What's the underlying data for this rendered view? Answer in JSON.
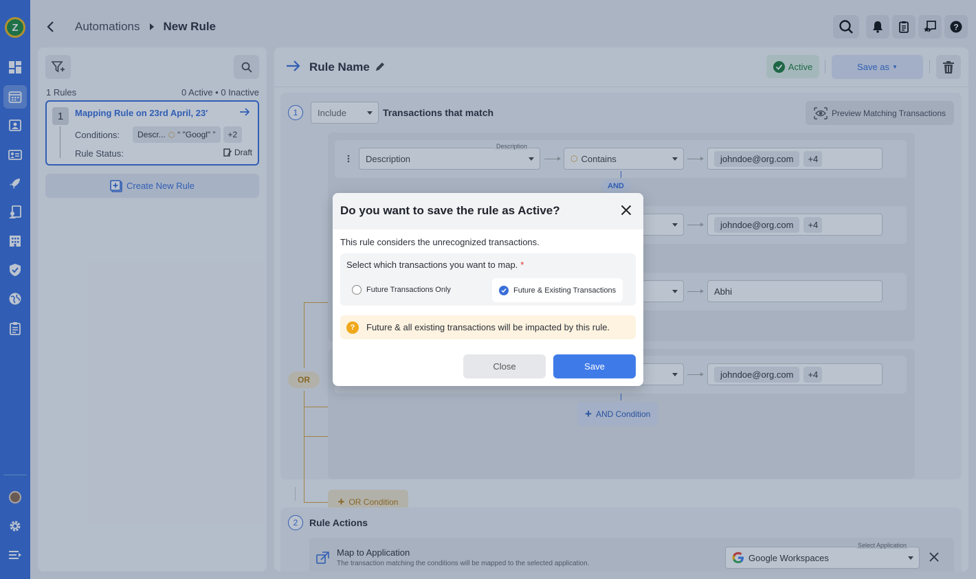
{
  "header": {
    "breadcrumb_parent": "Automations",
    "breadcrumb_current": "New Rule"
  },
  "rail": {
    "logo": "Z",
    "icons": [
      "dashboard-icon",
      "calendar-icon",
      "contacts-icon",
      "id-card-icon",
      "rocket-icon",
      "user-doc-icon",
      "building-icon",
      "shield-icon",
      "globe-icon",
      "clipboard-icon",
      "settings-icon",
      "menu-icon"
    ]
  },
  "rules_panel": {
    "count_label": "1 Rules",
    "stats_label": "0 Active • 0 Inactive",
    "card": {
      "number": "1",
      "title": "Mapping Rule on 23rd April, 23'",
      "conditions_label": "Conditions:",
      "chip_field": "Descr...",
      "chip_value": "“ \"Googl\" ”",
      "chip_more": "+2",
      "status_label": "Rule Status:",
      "status_value": "Draft"
    },
    "create_button": "Create New Rule"
  },
  "rule": {
    "name": "Rule Name",
    "status": "Active",
    "save_as": "Save as",
    "section1": {
      "step": "1",
      "include": "Include",
      "title": "Transactions that match",
      "preview_button": "Preview Matching Transactions",
      "row1": {
        "field_label": "Description",
        "field": "Description",
        "operator": "Contains",
        "value": "johndoe@org.com",
        "more": "+4"
      },
      "and_label": "AND",
      "row2": {
        "value": "johndoe@org.com",
        "more": "+4"
      },
      "row3": {
        "value": "Abhi"
      },
      "row4": {
        "value": "johndoe@org.com",
        "more": "+4"
      },
      "or_label": "OR",
      "and_condition_button": "AND Condition",
      "or_condition_button": "OR Condition"
    },
    "section2": {
      "step": "2",
      "title": "Rule Actions",
      "map_title": "Map to Application",
      "map_subtitle": "The transaction matching the conditions will be mapped to the selected application.",
      "app_label": "Select Application",
      "app_value": "Google Workspaces"
    }
  },
  "modal": {
    "title": "Do you want to save the rule as Active?",
    "description": "This rule considers the unrecognized transactions.",
    "question": "Select which transactions you want to map.",
    "required_mark": "*",
    "option_future": "Future Transactions Only",
    "option_all": "Future & Existing Transactions",
    "selected_option": "Future & Existing Transactions",
    "warning": "Future & all existing transactions will be impacted by this rule.",
    "close_button": "Close",
    "save_button": "Save"
  },
  "colors": {
    "primary": "#3a6fd8",
    "active_green": "#1e7b3a",
    "or_orange": "#d9a23a",
    "warning_bg": "#fdf3e0"
  }
}
